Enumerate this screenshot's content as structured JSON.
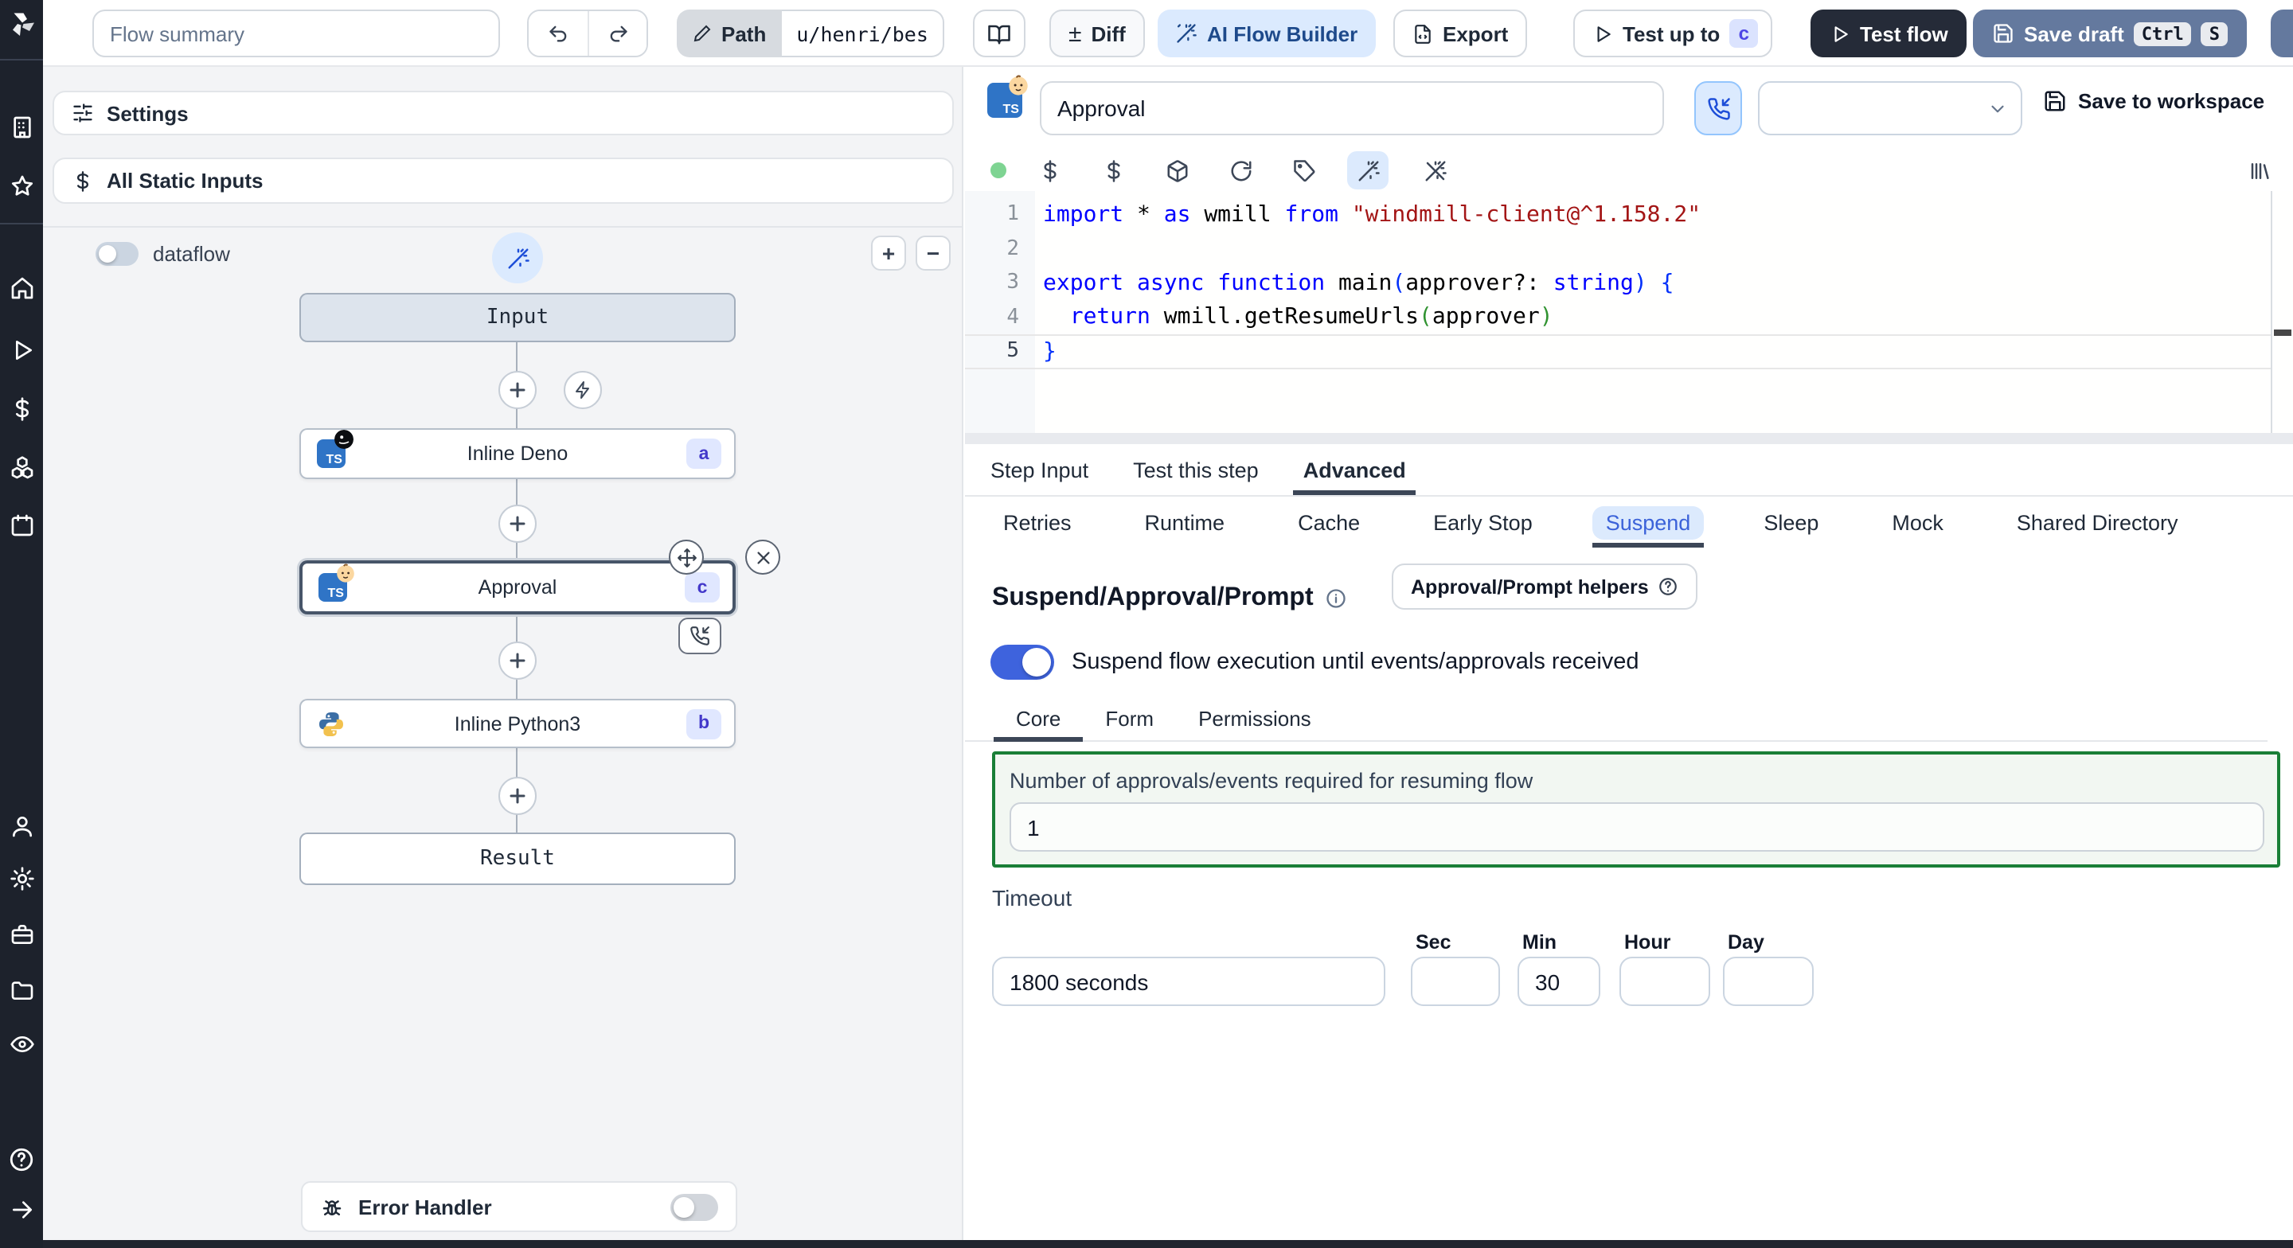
{
  "topbar": {
    "flow_summary_placeholder": "Flow summary",
    "path_label": "Path",
    "path_value": "u/henri/bes",
    "diff_label": "Diff",
    "diff_glyph": "±",
    "ai_label": "AI Flow Builder",
    "export_label": "Export",
    "test_up_to_label": "Test up to",
    "test_up_to_badge": "c",
    "test_flow_label": "Test flow",
    "save_draft_label": "Save draft",
    "kbd": [
      "Ctrl",
      "S"
    ]
  },
  "sidebar": {
    "icons": [
      "windmill-logo",
      "building",
      "star",
      "home",
      "play",
      "dollar",
      "boxes",
      "calendar",
      "user",
      "gear",
      "toolbox",
      "folder",
      "eye",
      "help",
      "arrow-right"
    ]
  },
  "left_panel": {
    "settings_label": "Settings",
    "static_inputs_label": "All Static Inputs",
    "dataflow_label": "dataflow",
    "zoom_in": "+",
    "zoom_out": "−",
    "nodes": {
      "input": "Input",
      "steps": [
        {
          "label": "Inline Deno",
          "badge": "a",
          "lang": "deno"
        },
        {
          "label": "Approval",
          "badge": "c",
          "lang": "bun"
        },
        {
          "label": "Inline Python3",
          "badge": "b",
          "lang": "python"
        }
      ],
      "result": "Result"
    },
    "error_handler_label": "Error Handler"
  },
  "right_panel": {
    "step_name_value": "Approval",
    "save_to_workspace_label": "Save to workspace",
    "code": {
      "lines": [
        [
          {
            "c": "k",
            "t": "import"
          },
          {
            "c": "d",
            "t": " * "
          },
          {
            "c": "k",
            "t": "as"
          },
          {
            "c": "d",
            "t": " wmill "
          },
          {
            "c": "k",
            "t": "from"
          },
          {
            "c": "d",
            "t": " "
          },
          {
            "c": "s",
            "t": "\"windmill-client@^1.158.2\""
          }
        ],
        [],
        [
          {
            "c": "k",
            "t": "export"
          },
          {
            "c": "d",
            "t": " "
          },
          {
            "c": "k",
            "t": "async"
          },
          {
            "c": "d",
            "t": " "
          },
          {
            "c": "k",
            "t": "function"
          },
          {
            "c": "d",
            "t": " main"
          },
          {
            "c": "pb",
            "t": "("
          },
          {
            "c": "d",
            "t": "approver?: "
          },
          {
            "c": "k",
            "t": "string"
          },
          {
            "c": "pb",
            "t": ") {"
          }
        ],
        [
          {
            "c": "d",
            "t": "  "
          },
          {
            "c": "k",
            "t": "return"
          },
          {
            "c": "d",
            "t": " wmill.getResumeUrls"
          },
          {
            "c": "pg",
            "t": "("
          },
          {
            "c": "d",
            "t": "approver"
          },
          {
            "c": "pg",
            "t": ")"
          }
        ],
        [
          {
            "c": "pb",
            "t": "}"
          }
        ]
      ]
    },
    "tabs": [
      "Step Input",
      "Test this step",
      "Advanced"
    ],
    "subtabs": [
      "Retries",
      "Runtime",
      "Cache",
      "Early Stop",
      "Suspend",
      "Sleep",
      "Mock",
      "Shared Directory"
    ],
    "suspend": {
      "heading": "Suspend/Approval/Prompt",
      "helpers_button": "Approval/Prompt helpers",
      "toggle_label": "Suspend flow execution until events/approvals received",
      "core_tabs": [
        "Core",
        "Form",
        "Permissions"
      ],
      "approvals_label": "Number of approvals/events required for resuming flow",
      "approvals_value": "1",
      "timeout_label": "Timeout",
      "timeout_value": "1800 seconds",
      "units": [
        "Sec",
        "Min",
        "Hour",
        "Day"
      ],
      "sec_value": "",
      "min_value": "30",
      "hour_value": "",
      "day_value": ""
    }
  },
  "colors": {
    "accent_blue": "#3e63dd",
    "light_blue_bg": "#dbeafe",
    "save_draft_bg": "#64799e",
    "dark_button_bg": "#252b38",
    "badge_bg": "#e0e7ff",
    "badge_text": "#4338ca",
    "green_border": "#1a7f37",
    "sidebar_bg": "#1d222c",
    "keyword": "#0000ff",
    "string": "#a31515"
  }
}
